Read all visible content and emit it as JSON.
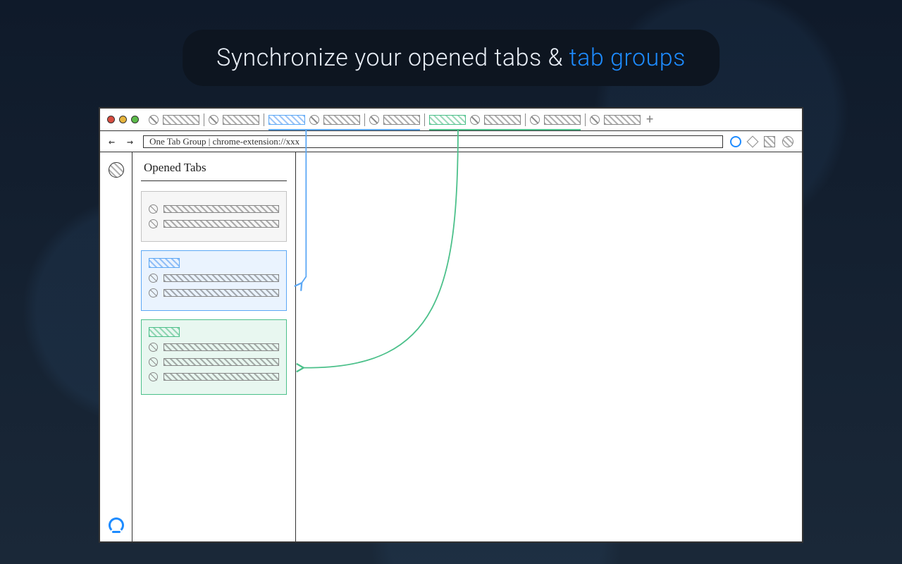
{
  "headline": {
    "pre": "Synchronize your opened tabs & ",
    "accent": "tab groups"
  },
  "urlbar": "One Tab Group | chrome-extension://xxx",
  "panel": {
    "title": "Opened Tabs"
  },
  "traffic_light_colors": [
    "#d84c3f",
    "#e6b43c",
    "#5cbb4a"
  ],
  "tab_group_colors": {
    "blue": "#5ca8f5",
    "green": "#4bc08a"
  },
  "tabstrip_layout": [
    "fav",
    "tab",
    "sep",
    "fav",
    "tab",
    "sep",
    "blue-tab",
    "fav",
    "tab",
    "sep",
    "fav",
    "tab",
    "sep",
    "green-tab",
    "fav",
    "tab",
    "sep",
    "fav",
    "tab",
    "sep",
    "fav",
    "tab",
    "plus"
  ],
  "sidebar_cards": [
    {
      "kind": "plain",
      "rows": 2
    },
    {
      "kind": "blue",
      "rows": 2
    },
    {
      "kind": "green",
      "rows": 3
    }
  ]
}
